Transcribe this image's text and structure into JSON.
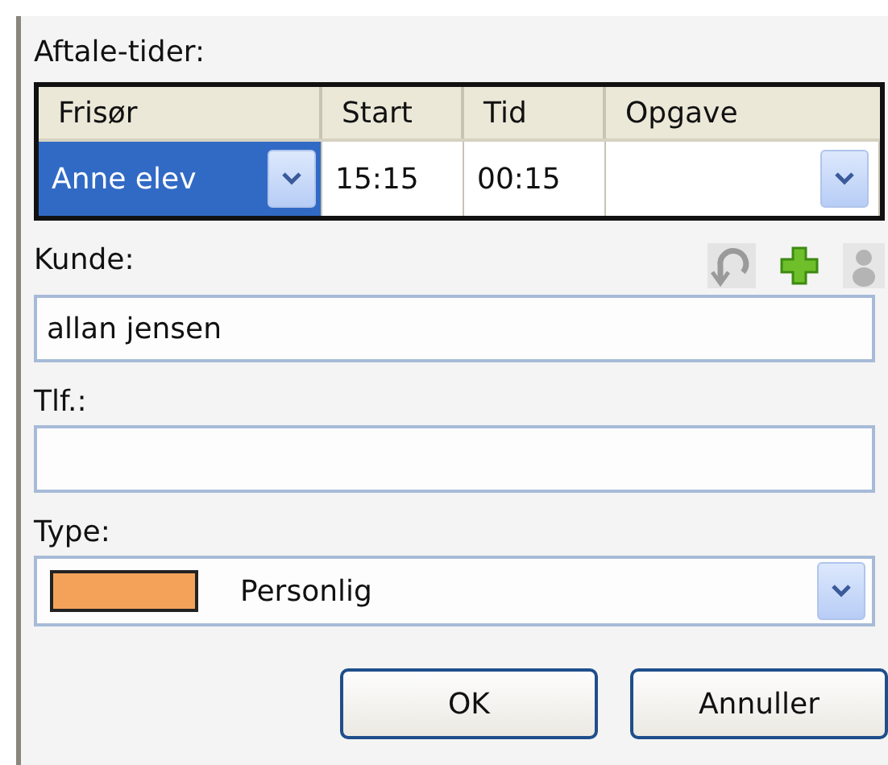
{
  "appointments": {
    "label": "Aftale-tider:",
    "columns": [
      "Frisør",
      "Start",
      "Tid",
      "Opgave"
    ],
    "row": {
      "hairdresser": "Anne elev",
      "start": "15:15",
      "duration": "00:15",
      "selected": true
    }
  },
  "customer": {
    "label": "Kunde:",
    "value": "allan jensen"
  },
  "phone": {
    "label": "Tlf.:"
  },
  "type": {
    "label": "Type:",
    "value": "Personlig",
    "color": "#f4a25a"
  },
  "buttons": [
    "OK",
    "Annuller"
  ]
}
